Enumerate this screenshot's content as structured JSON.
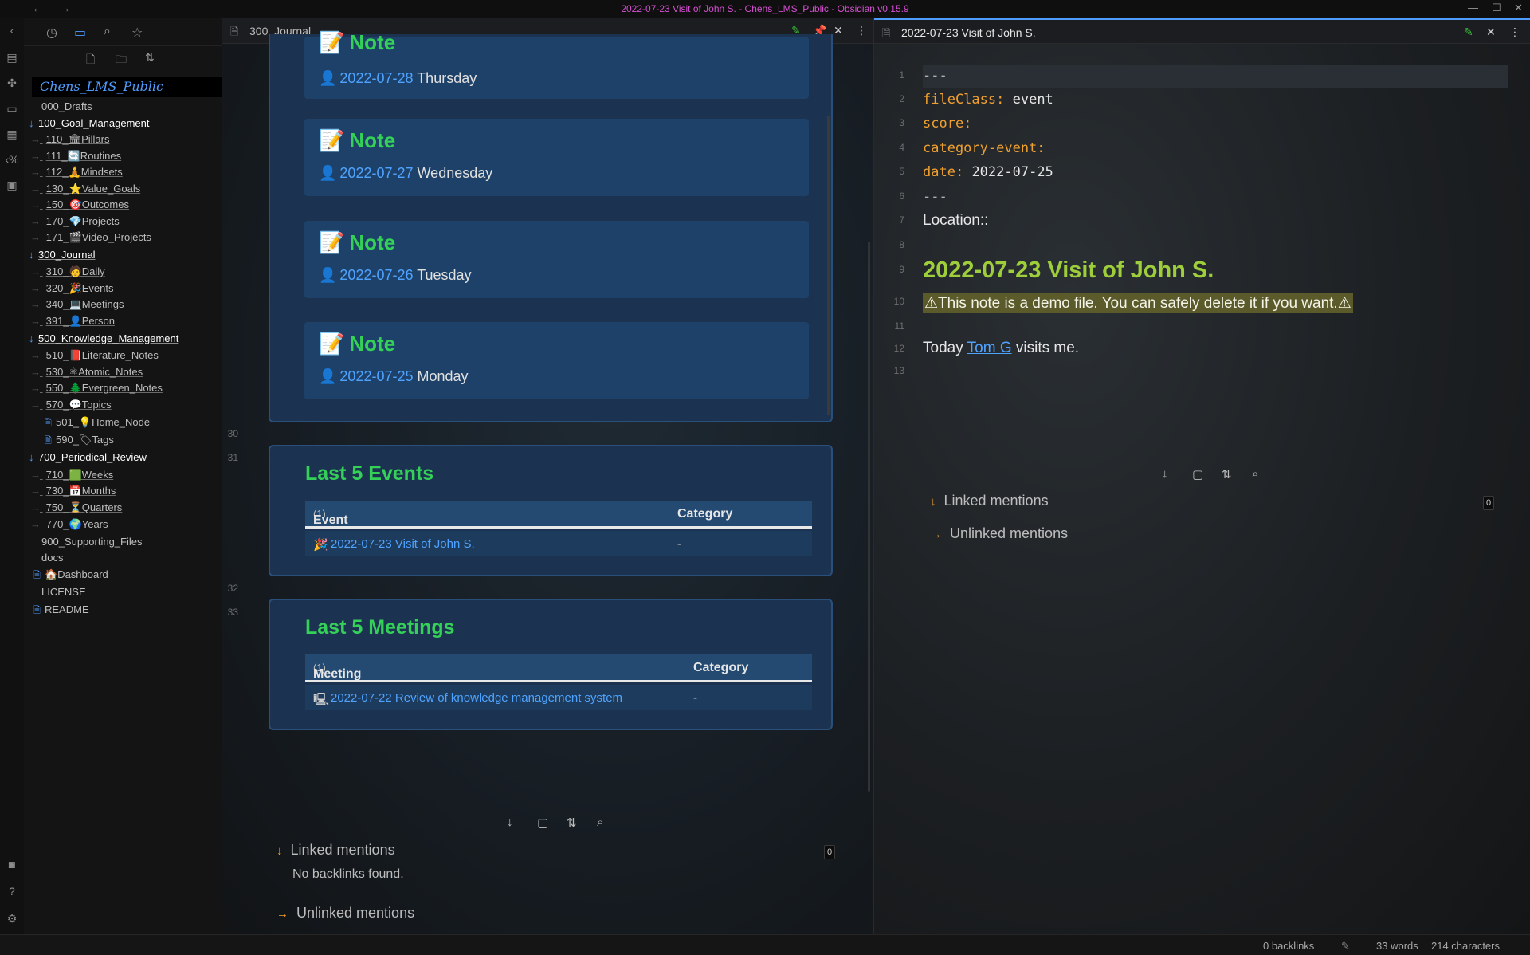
{
  "window": {
    "title": "2022-07-23 Visit of John S. - Chens_LMS_Public - Obsidian v0.15.9",
    "back": "←",
    "forward": "→"
  },
  "explorer": {
    "vault_name": "Chens_LMS_Public",
    "tree": [
      {
        "label": "000_Drafts",
        "kind": "folder-closed"
      },
      {
        "label": "100_Goal_Management",
        "kind": "folder-open"
      },
      {
        "label": "110_🏛Pillars",
        "kind": "sub"
      },
      {
        "label": "111_🔄Routines",
        "kind": "sub"
      },
      {
        "label": "112_🧘Mindsets",
        "kind": "sub"
      },
      {
        "label": "130_⭐Value_Goals",
        "kind": "sub"
      },
      {
        "label": "150_🎯Outcomes",
        "kind": "sub"
      },
      {
        "label": "170_💎Projects",
        "kind": "sub"
      },
      {
        "label": "171_🎬Video_Projects",
        "kind": "sub"
      },
      {
        "label": "300_Journal",
        "kind": "folder-open"
      },
      {
        "label": "310_🧑Daily",
        "kind": "sub"
      },
      {
        "label": "320_🎉Events",
        "kind": "sub"
      },
      {
        "label": "340_💻Meetings",
        "kind": "sub"
      },
      {
        "label": "391_👤Person",
        "kind": "sub"
      },
      {
        "label": "500_Knowledge_Management",
        "kind": "folder-open"
      },
      {
        "label": "510_📕Literature_Notes",
        "kind": "sub"
      },
      {
        "label": "530_⚛Atomic_Notes",
        "kind": "sub"
      },
      {
        "label": "550_🌲Evergreen_Notes",
        "kind": "sub"
      },
      {
        "label": "570_💬Topics",
        "kind": "sub"
      },
      {
        "label": "501_💡Home_Node",
        "kind": "file"
      },
      {
        "label": "590_🏷Tags",
        "kind": "file"
      },
      {
        "label": "700_Periodical_Review",
        "kind": "folder-open"
      },
      {
        "label": "710_🟩Weeks",
        "kind": "sub"
      },
      {
        "label": "730_📅Months",
        "kind": "sub"
      },
      {
        "label": "750_⏳Quarters",
        "kind": "sub"
      },
      {
        "label": "770_🌍Years",
        "kind": "sub"
      },
      {
        "label": "900_Supporting_Files",
        "kind": "folder-closed"
      },
      {
        "label": "docs",
        "kind": "folder-closed"
      },
      {
        "label": "🏠Dashboard",
        "kind": "file"
      },
      {
        "label": "LICENSE",
        "kind": "file-plain"
      },
      {
        "label": "README",
        "kind": "file"
      }
    ]
  },
  "left_pane": {
    "tab_title": "300_Journal",
    "note_cards": [
      {
        "head": "Note",
        "date": "2022-07-28",
        "weekday": "Thursday"
      },
      {
        "head": "Note",
        "date": "2022-07-27",
        "weekday": "Wednesday"
      },
      {
        "head": "Note",
        "date": "2022-07-26",
        "weekday": "Tuesday"
      },
      {
        "head": "Note",
        "date": "2022-07-25",
        "weekday": "Monday"
      }
    ],
    "line_numbers": [
      "30",
      "31",
      "32",
      "33"
    ],
    "events": {
      "title": "Last 5 Events",
      "col1": "Event",
      "count": "(1)",
      "col2": "Category",
      "row_link": "2022-07-23 Visit of John S.",
      "row_cat": "-"
    },
    "meetings": {
      "title": "Last 5 Meetings",
      "col1": "Meeting",
      "count": "(1)",
      "col2": "Category",
      "row_link": "2022-07-22 Review of knowledge management system",
      "row_cat": "-"
    },
    "backlinks": {
      "linked": "Linked mentions",
      "linked_count": "0",
      "none": "No backlinks found.",
      "unlinked": "Unlinked mentions"
    }
  },
  "right_pane": {
    "tab_title": "2022-07-23 Visit of John S.",
    "lines": {
      "n1": "1",
      "n2": "2",
      "n3": "3",
      "n4": "4",
      "n5": "5",
      "n6": "6",
      "n7": "7",
      "n8": "8",
      "n9": "9",
      "n10": "10",
      "n11": "11",
      "n12": "12",
      "n13": "13"
    },
    "frontmatter": {
      "fence": "---",
      "k1": "fileClass:",
      "v1": "event",
      "k2": "score:",
      "k3": "category-event:",
      "k4": "date:",
      "v4": "2022-07-25"
    },
    "location": "Location::",
    "heading": "2022-07-23 Visit of John S.",
    "warning": "⚠This note is a demo file. You can safely delete it if you want.⚠",
    "today_pre": "Today ",
    "today_link": "Tom G",
    "today_post": " visits me.",
    "backlinks": {
      "linked": "Linked mentions",
      "linked_count": "0",
      "unlinked": "Unlinked mentions"
    }
  },
  "status": {
    "backlinks": "0 backlinks",
    "words": "33 words",
    "chars": "214 characters"
  },
  "colors": {
    "accent": "#4f9cff",
    "heading_green": "#34d058",
    "h1_green": "#9ece3a",
    "key_orange": "#f0a030",
    "card_blue": "#1d4168"
  }
}
